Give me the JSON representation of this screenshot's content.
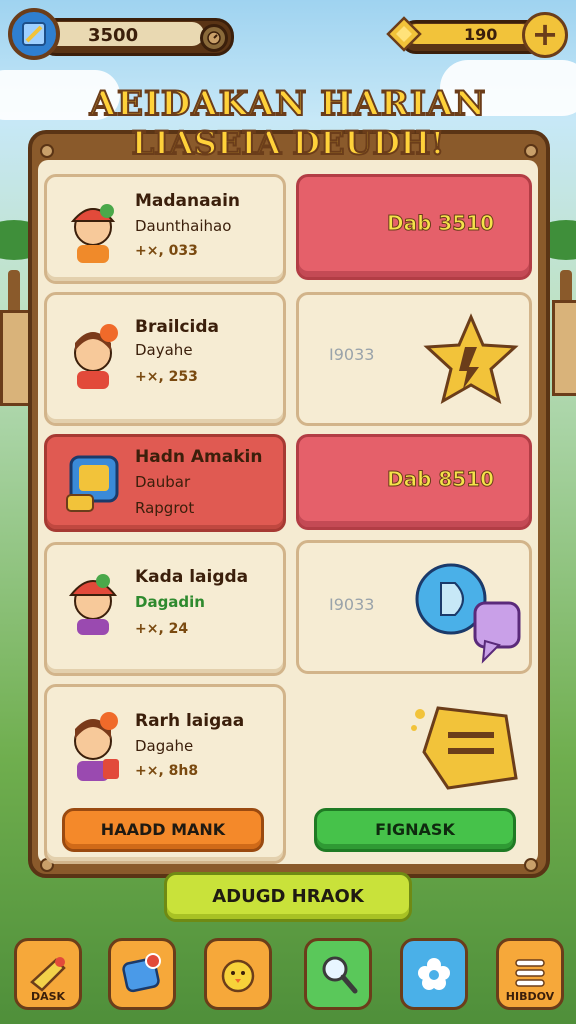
{
  "header": {
    "coins": "3500",
    "gems": "190"
  },
  "title": {
    "line1": "AEIDAKAN HARIAN",
    "line2": "LIASEIA DEUDH!"
  },
  "tasks": [
    {
      "name": "Madanaain",
      "sub": "Daunthaihao",
      "reward": "+×, 033",
      "action": "Dab 3510"
    },
    {
      "name": "Brailcida",
      "sub": "Dayahe",
      "reward": "+×, 253",
      "action": "I9033"
    },
    {
      "name": "Hadn Amakin",
      "sub": "Daubar",
      "sub2": "Rapgrot",
      "action": "Dab 8510"
    },
    {
      "name": "Kada laigda",
      "sub": "Dagadin",
      "reward": "+×, 24",
      "action": "I9033"
    },
    {
      "name": "Rarh laigaa",
      "sub": "Dagahe",
      "reward": "+×, 8h8"
    }
  ],
  "buttons": {
    "orange": "HAADD MANK",
    "green": "FIGNASK",
    "lime": "ADUGD HRAOK"
  },
  "nav": [
    {
      "icon": "horn-icon",
      "label": "DASK"
    },
    {
      "icon": "card-icon",
      "label": ""
    },
    {
      "icon": "chick-icon",
      "label": ""
    },
    {
      "icon": "magnifier-icon",
      "label": ""
    },
    {
      "icon": "flower-icon",
      "label": ""
    },
    {
      "icon": "menu-icon",
      "label": "HIBDOV"
    }
  ],
  "colors": {
    "board": "#8a5a2b",
    "card": "#f6ecd3",
    "red_card": "#e05a52",
    "gold": "#ffd23a"
  }
}
